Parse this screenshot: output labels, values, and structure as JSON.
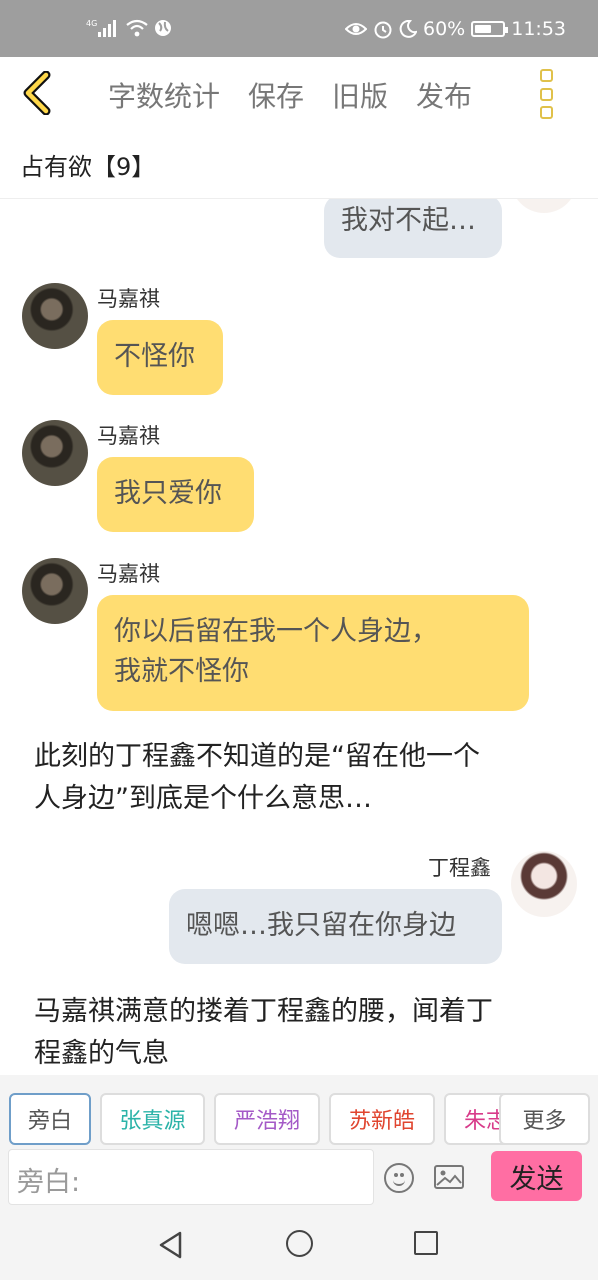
{
  "status_bar": {
    "network": "4G",
    "battery_percent": "60%",
    "battery_level": 0.6,
    "time": "11:53",
    "icons": [
      "signal-icon",
      "wifi-icon",
      "globe-icon",
      "eye-icon",
      "alarm-icon",
      "moon-icon",
      "battery-icon"
    ]
  },
  "toolbar": {
    "word_count": "字数统计",
    "save": "保存",
    "old_version": "旧版",
    "publish": "发布"
  },
  "doc": {
    "title": "占有欲【9】"
  },
  "messages": {
    "m1": {
      "text": "我对不起…"
    },
    "m2": {
      "name": "马嘉祺",
      "text": "不怪你"
    },
    "m3": {
      "name": "马嘉祺",
      "text": "我只爱你"
    },
    "m4": {
      "name": "马嘉祺",
      "line1": "你以后留在我一个人身边，",
      "line2": "我就不怪你"
    },
    "n1": {
      "line1": "此刻的丁程鑫不知道的是“留在他一个",
      "line2": "人身边”到底是个什么意思…"
    },
    "m5": {
      "name": "丁程鑫",
      "text": "嗯嗯…我只留在你身边"
    },
    "n2": {
      "line1": "马嘉祺满意的搂着丁程鑫的腰，闻着丁",
      "line2": "程鑫的气息"
    }
  },
  "characters": {
    "c0": {
      "label": "旁白",
      "color": "#555555"
    },
    "c1": {
      "label": "张真源",
      "color": "#2bb3a8"
    },
    "c2": {
      "label": "严浩翔",
      "color": "#a45ac7"
    },
    "c3": {
      "label": "苏新皓",
      "color": "#e0452f"
    },
    "c4": {
      "label": "朱志鑫",
      "color": "#d83b8a"
    },
    "more": "更多"
  },
  "input": {
    "placeholder": "旁白:",
    "send": "发送"
  },
  "colors": {
    "accent_yellow": "#ffdd72",
    "send_pink": "#ff6ea3",
    "bubble_gray": "#e3e8ee",
    "status_gray": "#9e9e9e"
  }
}
